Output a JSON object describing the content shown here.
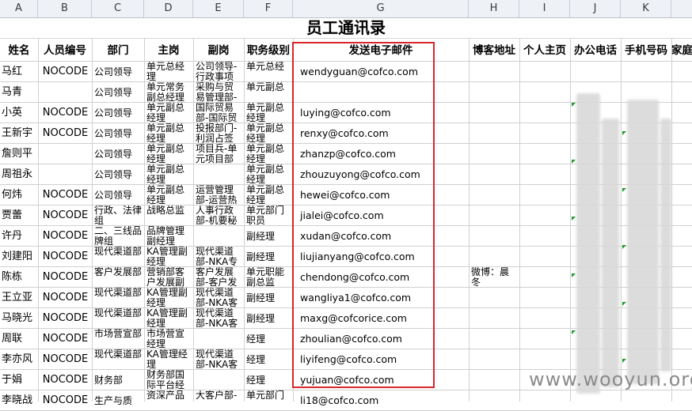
{
  "sheet": {
    "column_letters": [
      "A",
      "B",
      "C",
      "D",
      "E",
      "F",
      "G",
      "H",
      "I",
      "J",
      "K"
    ],
    "title": "员工通讯录",
    "headers": [
      "姓名",
      "人员编号",
      "部门",
      "主岗",
      "副岗",
      "职务级别",
      "发送电子邮件",
      "博客地址",
      "个人主页",
      "办公电话",
      "手机号码",
      "家庭"
    ],
    "rows": [
      {
        "name": "马红",
        "code": "NOCODE",
        "dept": "公司领导",
        "main": "单元总经理",
        "sub": "公司领导-行政事项",
        "level": "单元总经",
        "email": "wendyguan@cofco.com",
        "blog": ""
      },
      {
        "name": "马青",
        "code": "",
        "dept": "公司领导",
        "main": "单元常务副总经理",
        "sub": "采购与贸易管理部-",
        "level": "单元副总",
        "email": "",
        "blog": ""
      },
      {
        "name": "小英",
        "code": "NOCODE",
        "dept": "公司领导",
        "main": "单元副总经理",
        "sub": "国际贸易部-国际贸",
        "level": "单元副总经理",
        "email": "luying@cofco.com",
        "blog": ""
      },
      {
        "name": "王新宇",
        "code": "NOCODE",
        "dept": "公司领导",
        "main": "单元副总经理",
        "sub": "投报部门-利润占签",
        "level": "单元副总经理",
        "email": "renxy@cofco.com",
        "blog": ""
      },
      {
        "name": "詹则平",
        "code": "",
        "dept": "公司领导",
        "main": "单元副总经理",
        "sub": "项目兵-单元项目部",
        "level": "单元副总经理",
        "email": "zhanzp@cofco.com",
        "blog": ""
      },
      {
        "name": "周祖永",
        "code": "",
        "dept": "公司领导",
        "main": "单元副总经理",
        "sub": "",
        "level": "单元副总经理",
        "email": "zhouzuyong@cofco.com",
        "blog": ""
      },
      {
        "name": "何炜",
        "code": "NOCODE",
        "dept": "公司领导",
        "main": "单元副总经理",
        "sub": "运营管理部-运营热",
        "level": "单元副总经理",
        "email": "hewei@cofco.com",
        "blog": ""
      },
      {
        "name": "贾蕾",
        "code": "NOCODE",
        "dept": "行政、法律组",
        "main": "战略总监",
        "sub": "人事行政部-机要秘",
        "level": "单元部门职员",
        "email": "jialei@cofco.com",
        "blog": ""
      },
      {
        "name": "许丹",
        "code": "NOCODE",
        "dept": "二、三线品牌组",
        "main": "品牌管理副经理",
        "sub": "",
        "level": "副经理",
        "email": "xudan@cofco.com",
        "blog": ""
      },
      {
        "name": "刘建阳",
        "code": "NOCODE",
        "dept": "现代渠道部",
        "main": "KA管理副经理",
        "sub": "现代渠道部-NKA专",
        "level": "副经理",
        "email": "liujianyang@cofco.com",
        "blog": ""
      },
      {
        "name": "陈栋",
        "code": "NOCODE",
        "dept": "客户发展部",
        "main": "营销部客户发展副",
        "sub": "客户发展部-客户发",
        "level": "单元职能副总监",
        "email": "chendong@cofco.com",
        "blog": "微博：晨冬"
      },
      {
        "name": "王立亚",
        "code": "NOCODE",
        "dept": "现代渠道部",
        "main": "KA管理副经理",
        "sub": "现代渠道部-NKA客",
        "level": "副经理",
        "email": "wangliya1@cofco.com",
        "blog": ""
      },
      {
        "name": "马晓光",
        "code": "NOCODE",
        "dept": "现代渠道部",
        "main": "KA管理副经理",
        "sub": "现代渠道部-NKA客",
        "level": "副经理",
        "email": "maxg@cofcorice.com",
        "blog": ""
      },
      {
        "name": "周联",
        "code": "NOCODE",
        "dept": "市场营宣部",
        "main": "市场营宣经理",
        "sub": "",
        "level": "经理",
        "email": "zhoulian@cofco.com",
        "blog": ""
      },
      {
        "name": "李亦风",
        "code": "NOCODE",
        "dept": "现代渠道部",
        "main": "KA管理经理",
        "sub": "现代渠道部-NKA客",
        "level": "经理",
        "email": "liyifeng@cofco.com",
        "blog": ""
      },
      {
        "name": "于娟",
        "code": "NOCODE",
        "dept": "财务部",
        "main": "财务部国际平台经",
        "sub": "",
        "level": "经理",
        "email": "yujuan@cofco.com",
        "blog": ""
      },
      {
        "name": "李晓战",
        "code": "NOCODE",
        "dept": "生产与质",
        "main": "资深产品",
        "sub": "大客户部-",
        "level": "单元部门",
        "email": "li18@cofco.com",
        "blog": ""
      }
    ]
  },
  "watermark": "www.wooyun.org"
}
